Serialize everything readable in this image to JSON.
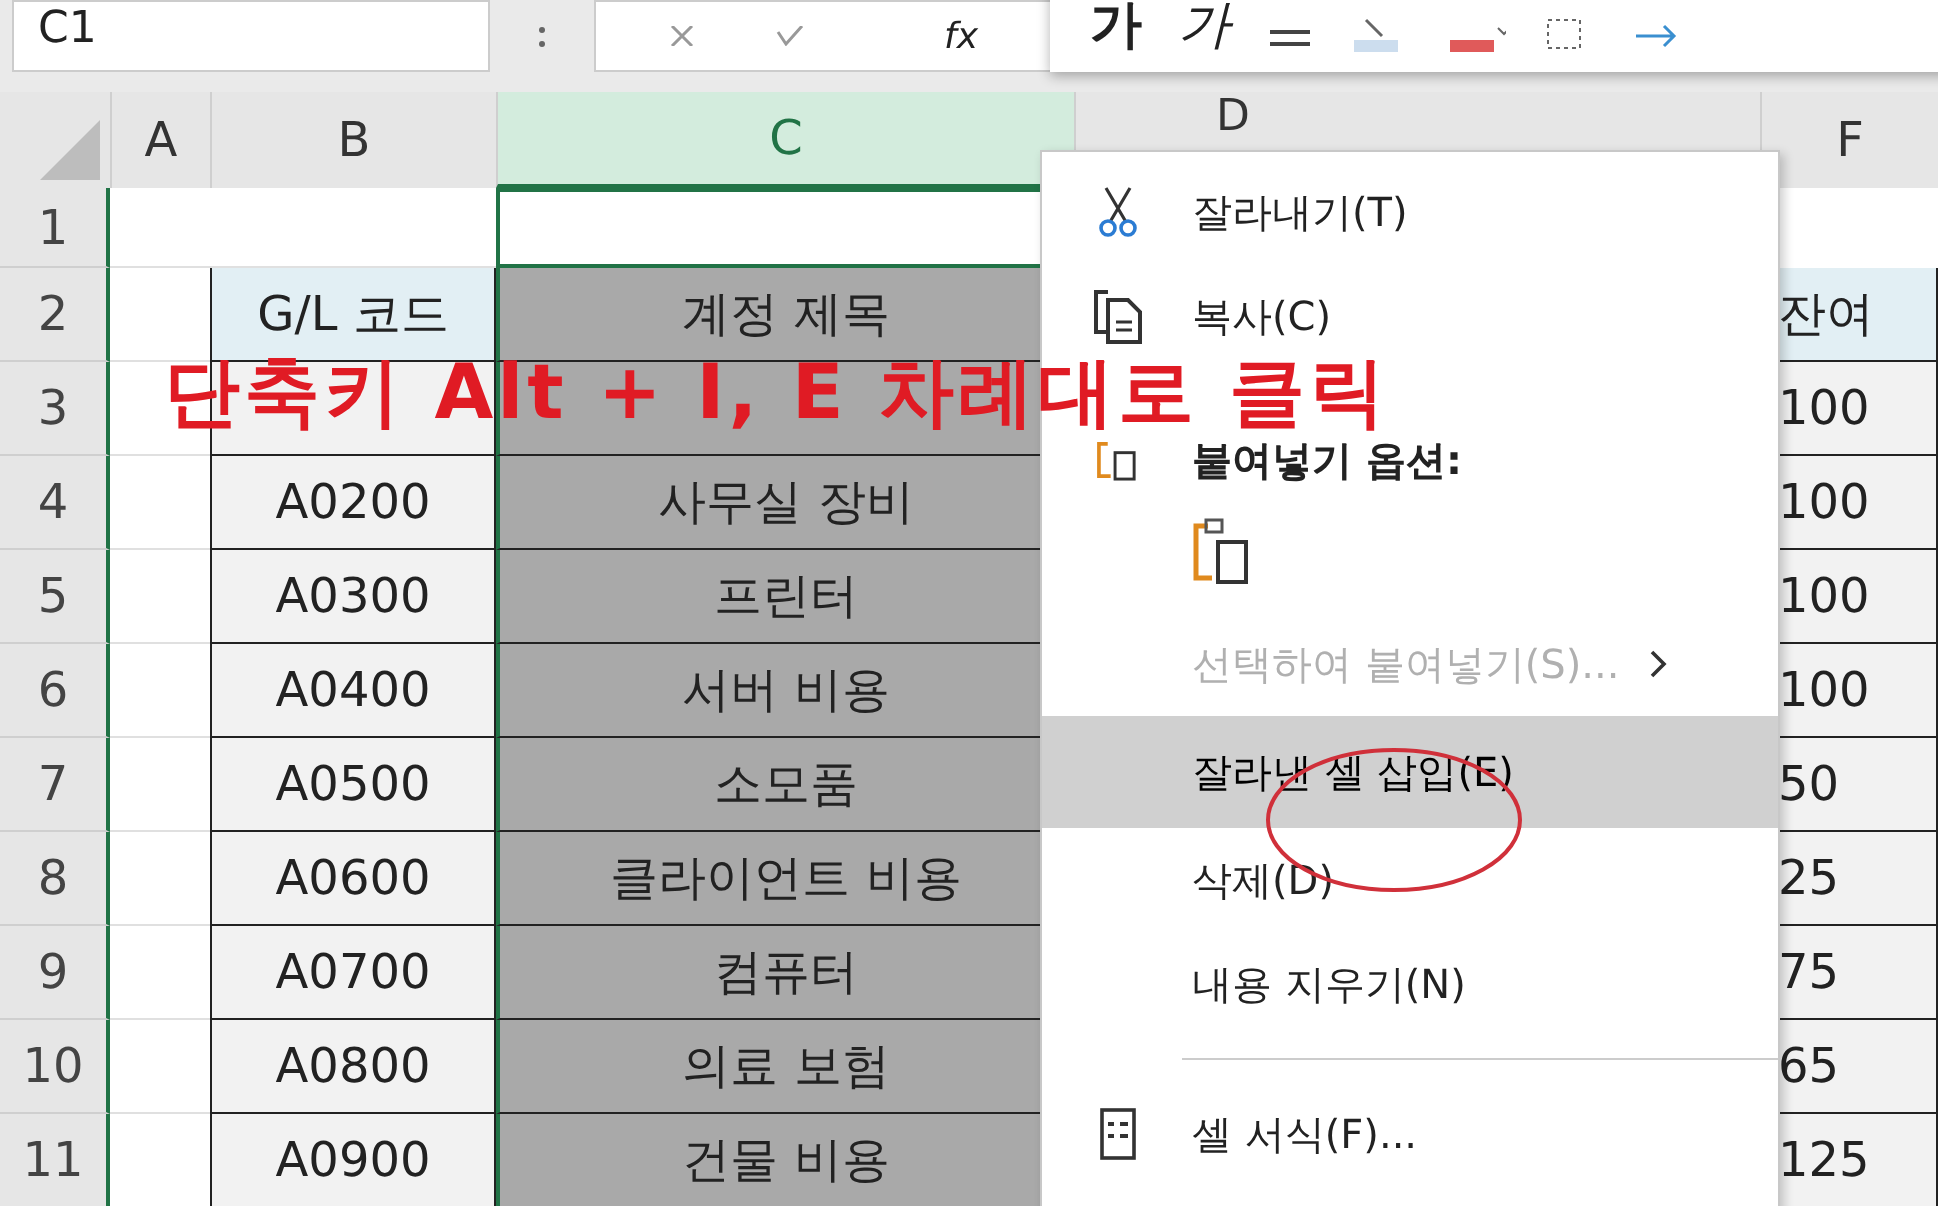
{
  "formula_bar": {
    "name_box": "C1",
    "function_label": "fx"
  },
  "mini_toolbar": {
    "bold_label": "가",
    "italic_label": "가"
  },
  "columns": [
    {
      "label": "A",
      "selected": false
    },
    {
      "label": "B",
      "selected": false
    },
    {
      "label": "C",
      "selected": true
    },
    {
      "label": "D",
      "selected": false
    },
    {
      "label": "F",
      "selected": false
    }
  ],
  "rows": [
    {
      "number": "1",
      "active": true
    },
    {
      "number": "2",
      "active": false,
      "code": "G/L 코드",
      "title": "계정 제목",
      "balance": "잔여",
      "header": true
    },
    {
      "number": "3",
      "active": false,
      "balance": "100",
      "header": false
    },
    {
      "number": "4",
      "active": false,
      "code": "A0200",
      "title": "사무실 장비",
      "balance": "100",
      "header": false
    },
    {
      "number": "5",
      "active": false,
      "code": "A0300",
      "title": "프린터",
      "balance": "100",
      "header": false
    },
    {
      "number": "6",
      "active": false,
      "code": "A0400",
      "title": "서버 비용",
      "balance": "100",
      "header": false
    },
    {
      "number": "7",
      "active": false,
      "code": "A0500",
      "title": "소모품",
      "balance": "50",
      "header": false
    },
    {
      "number": "8",
      "active": false,
      "code": "A0600",
      "title": "클라이언트 비용",
      "balance": "25",
      "header": false
    },
    {
      "number": "9",
      "active": false,
      "code": "A0700",
      "title": "컴퓨터",
      "balance": "75",
      "header": false
    },
    {
      "number": "10",
      "active": false,
      "code": "A0800",
      "title": "의료 보험",
      "balance": "65",
      "header": false
    },
    {
      "number": "11",
      "active": false,
      "code": "A0900",
      "title": "건물 비용",
      "balance": "125",
      "header": false
    }
  ],
  "context_menu": [
    {
      "kind": "cut",
      "label": "잘라내기(T)",
      "disabled": false,
      "highlighted": false
    },
    {
      "kind": "copy",
      "label": "복사(C)",
      "disabled": false,
      "highlighted": false
    },
    {
      "kind": "heading",
      "label": "붙여넣기 옵션:",
      "disabled": false,
      "highlighted": false
    },
    {
      "kind": "pasteicon",
      "disabled": false,
      "highlighted": false
    },
    {
      "kind": "submenu",
      "label": "선택하여 붙여넣기(S)...",
      "disabled": true,
      "highlighted": false
    },
    {
      "kind": "plain",
      "label": "잘라낸 셀 삽입(E)",
      "disabled": false,
      "highlighted": true
    },
    {
      "kind": "plain",
      "label": "삭제(D)",
      "disabled": false,
      "highlighted": false
    },
    {
      "kind": "plain",
      "label": "내용 지우기(N)",
      "disabled": false,
      "highlighted": false
    },
    {
      "kind": "separator"
    },
    {
      "kind": "format",
      "label": "셀 서식(F)...",
      "disabled": false,
      "highlighted": false
    }
  ],
  "annotation": {
    "text": "단축키 Alt + I, E 차례대로 클릭"
  }
}
